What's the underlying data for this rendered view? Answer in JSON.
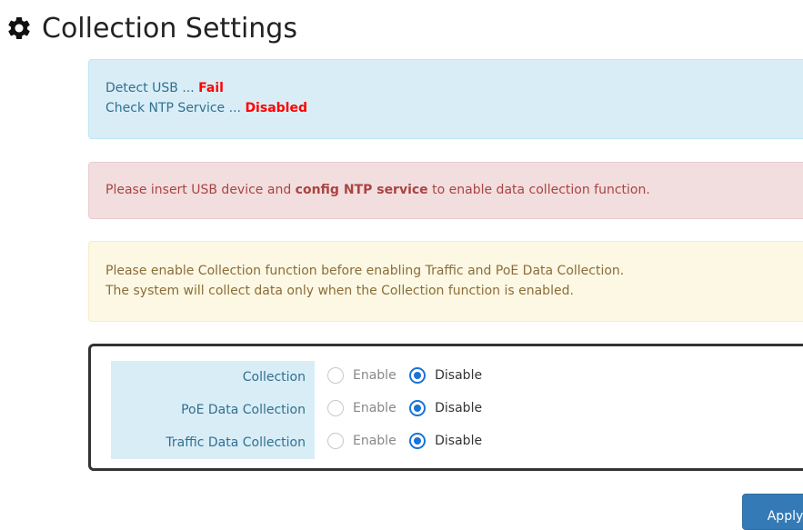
{
  "page": {
    "title": "Collection Settings",
    "title_icon": "gear-icon"
  },
  "status": {
    "usb_label": "Detect USB ...",
    "usb_value": "Fail",
    "ntp_label": "Check NTP Service ...",
    "ntp_value": "Disabled",
    "value_color": "#ff0000"
  },
  "danger_alert": {
    "prefix": "Please insert USB device and",
    "strong": "config NTP service",
    "suffix": "to enable data collection function."
  },
  "warning_alert": {
    "line1": "Please enable Collection function before enabling Traffic and PoE Data Collection.",
    "line2": "The system will collect data only when the Collection function is enabled."
  },
  "settings": {
    "rows": [
      {
        "label": "Collection",
        "enable_label": "Enable",
        "disable_label": "Disable",
        "selected": "Disable"
      },
      {
        "label": "PoE Data Collection",
        "enable_label": "Enable",
        "disable_label": "Disable",
        "selected": "Disable"
      },
      {
        "label": "Traffic Data Collection",
        "enable_label": "Enable",
        "disable_label": "Disable",
        "selected": "Disable"
      }
    ]
  },
  "actions": {
    "apply_label": "Apply",
    "apply_color": "#337ab7"
  }
}
